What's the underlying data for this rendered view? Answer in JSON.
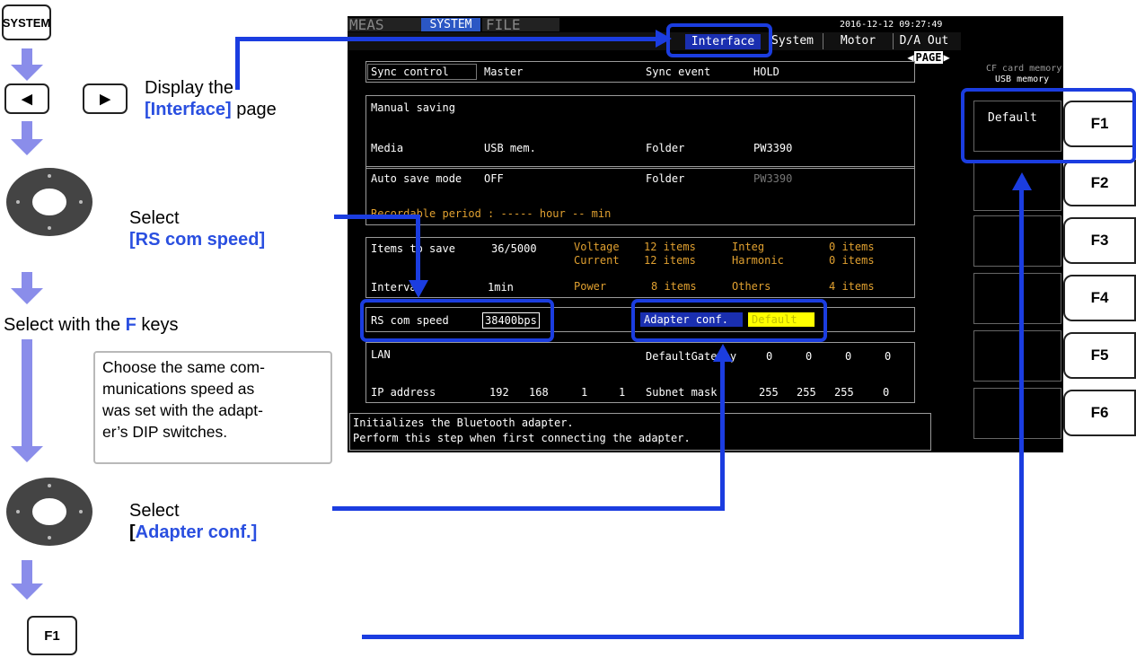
{
  "flow": {
    "system_key": "SYSTEM",
    "left_key": "◀",
    "right_key": "▶",
    "step1_text": "Display the",
    "step1_bold": "[Interface]",
    "step1_after": " page",
    "step2_text": "Select",
    "step2_bold": "[RS com speed]",
    "step3_pre": "Select with the ",
    "step3_bold": "F",
    "step3_post": " keys",
    "note_text": "Choose the same com-munications speed as was set with the adapt-er's DIP switches.",
    "note_lines": [
      "Choose the same com-",
      "munications speed as",
      "was set with the adapt-",
      "er’s DIP switches."
    ],
    "step4_text": "Select",
    "step4_bracket": "[",
    "step4_bold": "Adapter conf.]",
    "f1_key": "F1"
  },
  "screen": {
    "top_tabs": [
      "MEAS",
      "SYSTEM",
      "FILE"
    ],
    "datetime": "2016-12-12 09:27:49",
    "sub_tabs": [
      "Interface",
      "System",
      "Motor",
      "D/A Out"
    ],
    "page_label": "PAGE",
    "cf_label1": "CF card memory",
    "cf_label2": "USB memory",
    "sync_control_label": "Sync control",
    "sync_control_value": "Master",
    "sync_event_label": "Sync event",
    "sync_event_value": "HOLD",
    "manual_saving_label": "Manual saving",
    "media_label": "Media",
    "media_value": "USB mem.",
    "folder_label": "Folder",
    "folder_value": "PW3390",
    "auto_save_label": "Auto save mode",
    "auto_save_value": "OFF",
    "folder2_label": "Folder",
    "folder2_value": "PW3390",
    "period_text": "Recordable period  :  ----- hour  -- min",
    "items_label": "Items to save",
    "items_value": "36/5000",
    "interval_label": "Interval",
    "interval_value": "1min",
    "items_grid": [
      [
        "Voltage",
        "12 items",
        "Integ",
        "0 items"
      ],
      [
        "Current",
        "12 items",
        "Harmonic",
        "0 items"
      ],
      [
        "Power",
        "8 items",
        "Others",
        "4 items"
      ]
    ],
    "rs_label": "RS com speed",
    "rs_value": "38400bps",
    "adapter_label": "Adapter conf.",
    "adapter_value": "Default",
    "lan_label": "LAN",
    "gateway_label": "DefaultGateway",
    "gateway": [
      "0",
      "0",
      "0",
      "0"
    ],
    "ip_label": "IP address",
    "ip": [
      "192",
      "168",
      "1",
      "1"
    ],
    "subnet_label": "Subnet mask",
    "subnet": [
      "255",
      "255",
      "255",
      "0"
    ],
    "help_line1": "Initializes the Bluetooth adapter.",
    "help_line2": "Perform this step when first connecting the adapter.",
    "default_label": "Default"
  },
  "fkeys": [
    "F1",
    "F2",
    "F3",
    "F4",
    "F5",
    "F6"
  ],
  "colors": {
    "highlight": "#1b3de0",
    "flow_arrow": "#8a8dea",
    "text_blue": "#2a4fe0",
    "yellow": "#ffff00"
  }
}
